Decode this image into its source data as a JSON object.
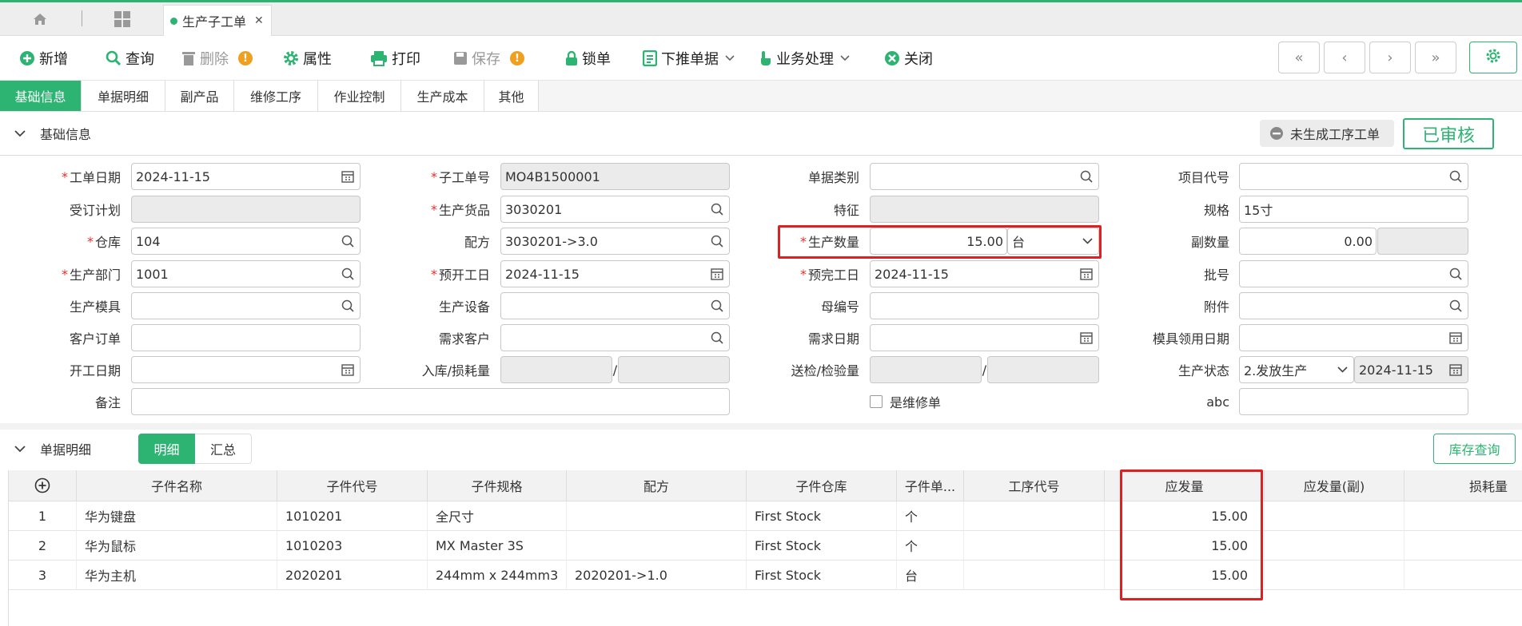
{
  "tabbar": {
    "doc_tab": "生产子工单",
    "close": "✕"
  },
  "toolbar": {
    "add": "新增",
    "query": "查询",
    "delete": "删除",
    "attributes": "属性",
    "print": "打印",
    "save": "保存",
    "lock": "锁单",
    "push_down": "下推单据",
    "business": "业务处理",
    "close": "关闭",
    "warn_mark": "!"
  },
  "nav": {
    "first": "«",
    "prev": "‹",
    "next": "›",
    "last": "»"
  },
  "section_tabs": [
    "基础信息",
    "单据明细",
    "副产品",
    "维修工序",
    "作业控制",
    "生产成本",
    "其他"
  ],
  "basic": {
    "title": "基础信息",
    "process_badge": "未生成工序工单",
    "audit_status": "已审核",
    "fields": {
      "work_date": {
        "label": "工单日期",
        "value": "2024-11-15"
      },
      "sub_order_no": {
        "label": "子工单号",
        "value": "MO4B1500001"
      },
      "doc_category": {
        "label": "单据类别",
        "value": ""
      },
      "project_code": {
        "label": "项目代号",
        "value": ""
      },
      "order_plan": {
        "label": "受订计划",
        "value": ""
      },
      "product": {
        "label": "生产货品",
        "value": "3030201"
      },
      "feature": {
        "label": "特征",
        "value": ""
      },
      "spec": {
        "label": "规格",
        "value": "15寸"
      },
      "warehouse": {
        "label": "仓库",
        "value": "104"
      },
      "formula": {
        "label": "配方",
        "value": "3030201->3.0"
      },
      "quantity": {
        "label": "生产数量",
        "value": "15.00",
        "unit": "台"
      },
      "sub_quantity": {
        "label": "副数量",
        "value": "0.00"
      },
      "department": {
        "label": "生产部门",
        "value": "1001"
      },
      "plan_start": {
        "label": "预开工日",
        "value": "2024-11-15"
      },
      "plan_finish": {
        "label": "预完工日",
        "value": "2024-11-15"
      },
      "batch_no": {
        "label": "批号",
        "value": ""
      },
      "mold": {
        "label": "生产模具",
        "value": ""
      },
      "equipment": {
        "label": "生产设备",
        "value": ""
      },
      "parent_no": {
        "label": "母编号",
        "value": ""
      },
      "attachment": {
        "label": "附件",
        "value": ""
      },
      "customer_order": {
        "label": "客户订单",
        "value": ""
      },
      "demand_customer": {
        "label": "需求客户",
        "value": ""
      },
      "demand_date": {
        "label": "需求日期",
        "value": ""
      },
      "mold_use_date": {
        "label": "模具领用日期",
        "value": ""
      },
      "start_date": {
        "label": "开工日期",
        "value": ""
      },
      "inbound_loss": {
        "label": "入库/损耗量",
        "sep": "/"
      },
      "inspection": {
        "label": "送检/检验量",
        "sep": "/"
      },
      "prod_status": {
        "label": "生产状态",
        "value": "2.发放生产",
        "date": "2024-11-15"
      },
      "remark": {
        "label": "备注",
        "value": ""
      },
      "is_repair": {
        "label": "是维修单"
      },
      "abc": {
        "label": "abc",
        "value": ""
      }
    }
  },
  "detail": {
    "title": "单据明细",
    "toggle_detail": "明细",
    "toggle_summary": "汇总",
    "stock_query": "库存查询",
    "columns": [
      "子件名称",
      "子件代号",
      "子件规格",
      "配方",
      "子件仓库",
      "子件单...",
      "工序代号",
      "应发量",
      "应发量(副)",
      "损耗量"
    ],
    "rows": [
      {
        "no": "1",
        "name": "华为键盘",
        "code": "1010201",
        "spec": "全尺寸",
        "formula": "",
        "warehouse": "First Stock",
        "unit": "个",
        "process": "",
        "qty": "15.00"
      },
      {
        "no": "2",
        "name": "华为鼠标",
        "code": "1010203",
        "spec": "MX Master 3S",
        "formula": "",
        "warehouse": "First Stock",
        "unit": "个",
        "process": "",
        "qty": "15.00"
      },
      {
        "no": "3",
        "name": "华为主机",
        "code": "2020201",
        "spec": "244mm x 244mm3",
        "formula": "2020201->1.0",
        "warehouse": "First Stock",
        "unit": "台",
        "process": "",
        "qty": "15.00"
      }
    ]
  },
  "colors": {
    "brand": "#2db472",
    "required": "#e03030",
    "highlight": "#e02020"
  }
}
